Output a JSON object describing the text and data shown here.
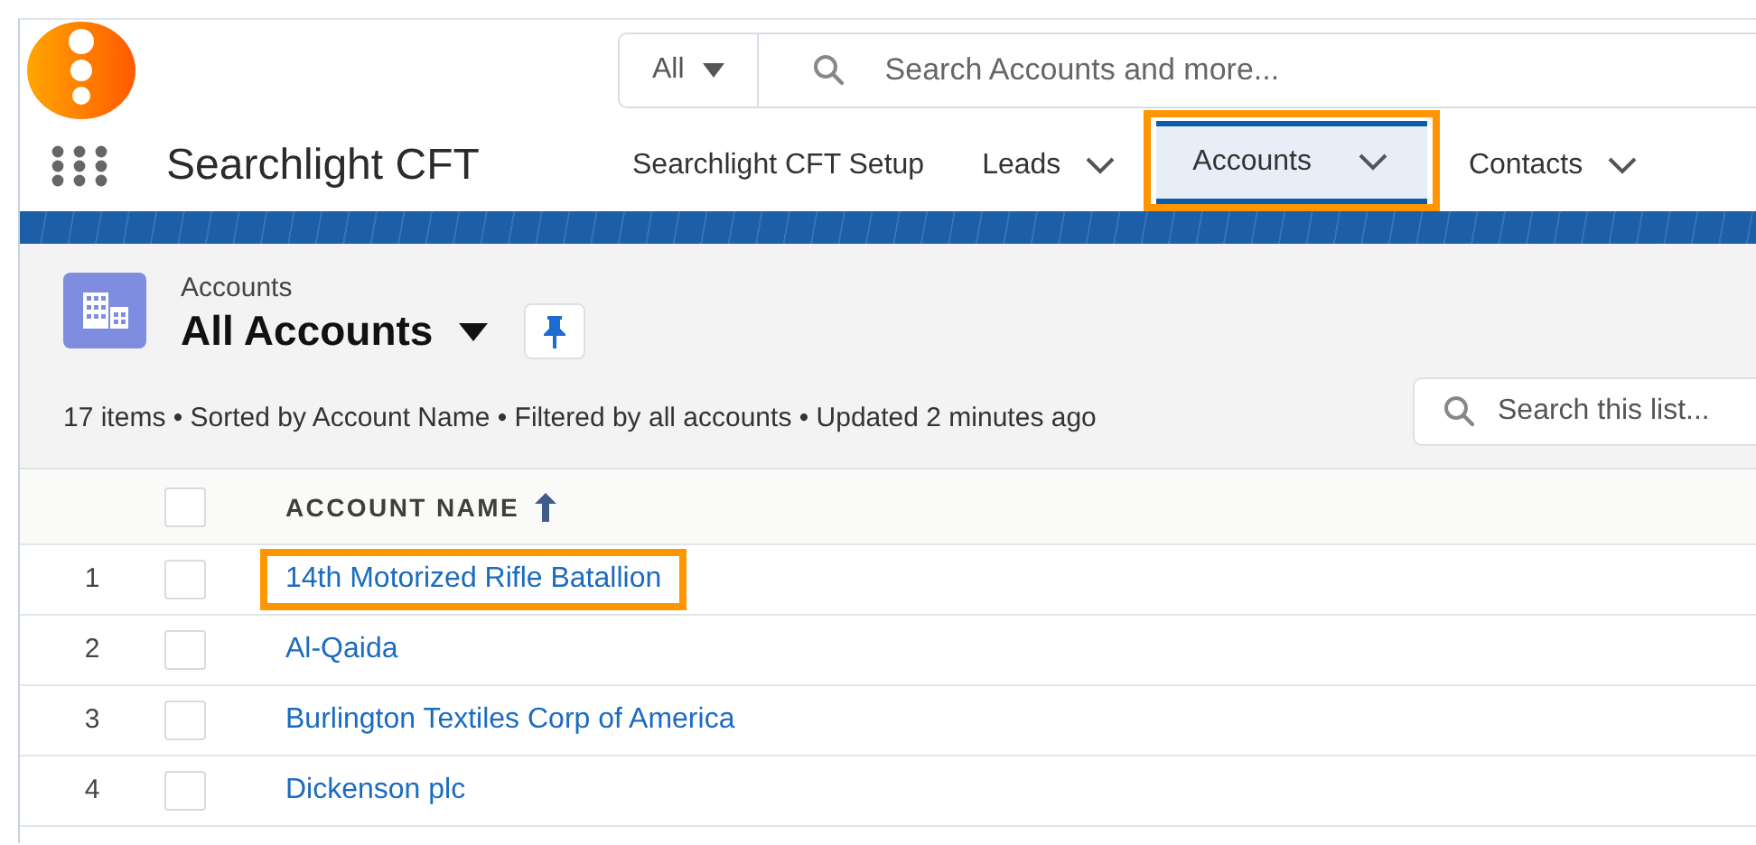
{
  "app": {
    "name": "Searchlight CFT"
  },
  "search": {
    "scope": "All",
    "placeholder": "Search Accounts and more..."
  },
  "nav_tabs": [
    {
      "label": "Searchlight CFT Setup",
      "selected": false,
      "has_menu": false,
      "highlighted": false
    },
    {
      "label": "Leads",
      "selected": false,
      "has_menu": true,
      "highlighted": false
    },
    {
      "label": "Accounts",
      "selected": true,
      "has_menu": true,
      "highlighted": true
    },
    {
      "label": "Contacts",
      "selected": false,
      "has_menu": true,
      "highlighted": false
    }
  ],
  "list_view": {
    "object": "Accounts",
    "title": "All Accounts",
    "pinned": true,
    "meta": "17 items • Sorted by Account Name • Filtered by all accounts • Updated 2 minutes ago",
    "search_placeholder": "Search this list...",
    "all_checked": false,
    "columns": [
      {
        "label": "ACCOUNT NAME",
        "sort_ascending": true
      }
    ],
    "rows": [
      {
        "number": "1",
        "name": "14th Motorized Rifle Batallion",
        "checked": false,
        "highlighted": true
      },
      {
        "number": "2",
        "name": "Al-Qaida",
        "checked": false,
        "highlighted": false
      },
      {
        "number": "3",
        "name": "Burlington Textiles Corp of America",
        "checked": false,
        "highlighted": false
      },
      {
        "number": "4",
        "name": "Dickenson plc",
        "checked": false,
        "highlighted": false
      }
    ]
  }
}
